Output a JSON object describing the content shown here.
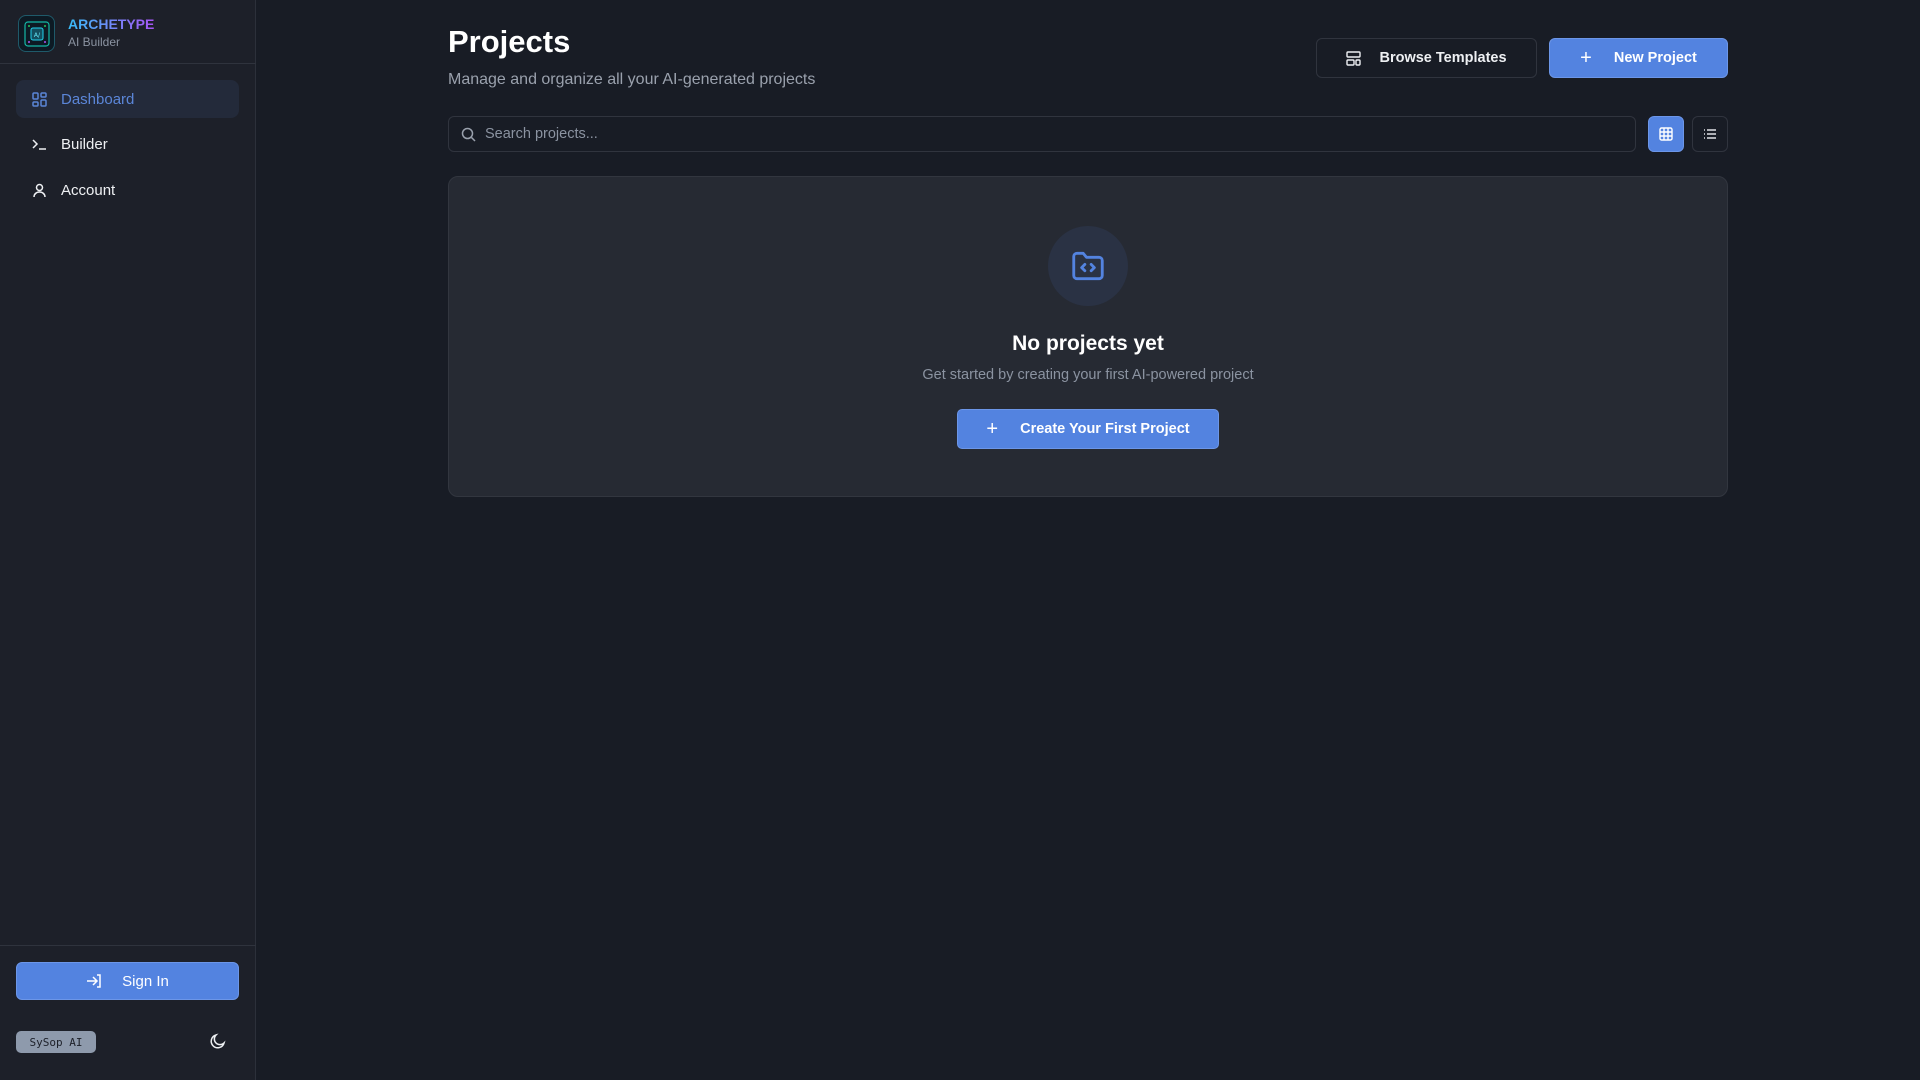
{
  "app": {
    "name": "ARCHETYPE",
    "tagline": "AI Builder",
    "logo_text": "A/"
  },
  "sidebar": {
    "items": [
      {
        "label": "Dashboard",
        "icon": "dashboard-grid-icon",
        "active": true
      },
      {
        "label": "Builder",
        "icon": "terminal-icon"
      },
      {
        "label": "Account",
        "icon": "user-icon"
      }
    ],
    "sign_in": "Sign In",
    "badge": "SySop AI",
    "theme_icon": "moon-icon"
  },
  "header": {
    "title": "Projects",
    "subtitle": "Manage and organize all your AI-generated projects",
    "browse_templates": "Browse Templates",
    "new_project": "New Project"
  },
  "search": {
    "placeholder": "Search projects...",
    "value": ""
  },
  "view": {
    "selected": "grid",
    "options": [
      "grid",
      "list"
    ]
  },
  "empty": {
    "title": "No projects yet",
    "subtitle": "Get started by creating your first AI-powered project",
    "cta": "Create Your First Project"
  },
  "colors": {
    "accent": "#5383e0",
    "background": "#181c25",
    "sidebar": "#1d2029",
    "card": "#262a33"
  }
}
